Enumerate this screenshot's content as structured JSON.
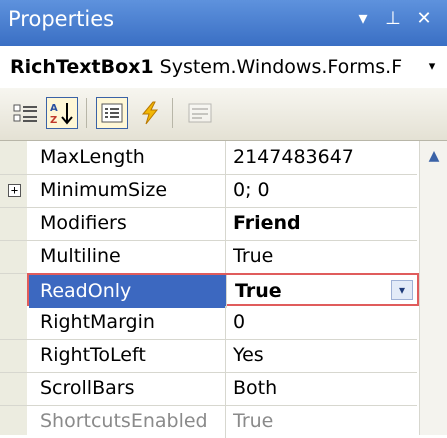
{
  "panel": {
    "title": "Properties",
    "buttons": {
      "dropdown": "▾",
      "pin": "⊥",
      "close": "✕"
    }
  },
  "object_selector": {
    "name": "RichTextBox1",
    "type": "System.Windows.Forms.F",
    "arrow": "▾"
  },
  "toolbar": {
    "buttons": [
      {
        "name": "categorized-icon",
        "pressed": false
      },
      {
        "name": "alphabetical-icon",
        "pressed": true
      },
      {
        "name": "properties-icon",
        "pressed": true
      },
      {
        "name": "events-icon",
        "pressed": false
      },
      {
        "name": "property-pages-icon",
        "pressed": false,
        "disabled": true
      }
    ]
  },
  "grid": {
    "rows": [
      {
        "name": "MaxLength",
        "value": "2147483647"
      },
      {
        "name": "MinimumSize",
        "value": "0; 0",
        "expandable": true,
        "expander": "+"
      },
      {
        "name": "Modifiers",
        "value": "Friend",
        "bold": true
      },
      {
        "name": "Multiline",
        "value": "True"
      },
      {
        "name": "ReadOnly",
        "value": "True",
        "selected": true,
        "dropdown": "▾"
      },
      {
        "name": "RightMargin",
        "value": "0"
      },
      {
        "name": "RightToLeft",
        "value": "Yes"
      },
      {
        "name": "ScrollBars",
        "value": "Both"
      },
      {
        "name": "ShortcutsEnabled",
        "value": "True",
        "partial": true
      }
    ],
    "scroll_up": "▲"
  },
  "colors": {
    "titlebar": "#3a6fc4",
    "selection": "#3c68c0",
    "highlight_border": "#e05c5c"
  }
}
